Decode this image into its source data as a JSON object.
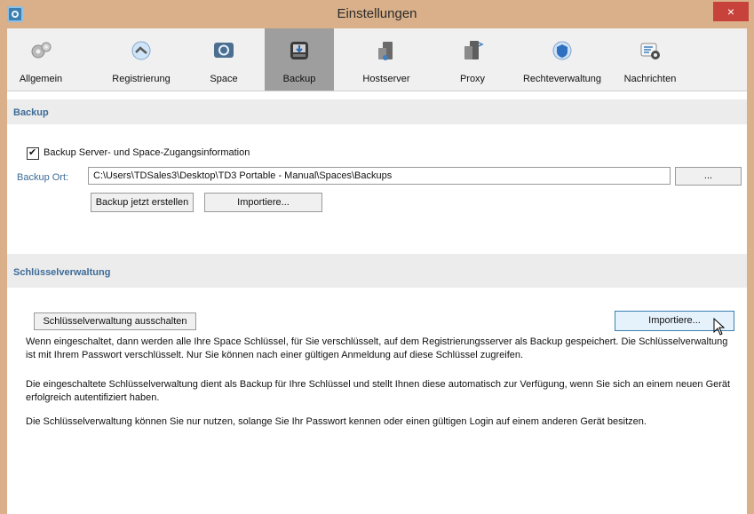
{
  "window": {
    "title": "Einstellungen",
    "close_glyph": "×"
  },
  "tabs": [
    {
      "label": "Allgemein",
      "icon": "gears-icon"
    },
    {
      "label": "Registrierung",
      "icon": "registration-icon"
    },
    {
      "label": "Space",
      "icon": "space-icon"
    },
    {
      "label": "Backup",
      "icon": "backup-icon",
      "active": true
    },
    {
      "label": "Hostserver",
      "icon": "hostserver-icon"
    },
    {
      "label": "Proxy",
      "icon": "proxy-icon"
    },
    {
      "label": "Rechteverwaltung",
      "icon": "rights-icon"
    },
    {
      "label": "Nachrichten",
      "icon": "messages-icon"
    }
  ],
  "backup": {
    "section_title": "Backup",
    "checkbox_label": "Backup Server- und Space-Zugangsinformation",
    "checkbox_checked": true,
    "location_label": "Backup Ort:",
    "location_value": "C:\\Users\\TDSales3\\Desktop\\TD3 Portable - Manual\\Spaces\\Backups",
    "browse_label": "...",
    "create_label": "Backup jetzt erstellen",
    "import_label": "Importiere..."
  },
  "keys": {
    "section_title": "Schlüsselverwaltung",
    "toggle_label": "Schlüsselverwaltung ausschalten",
    "import_label": "Importiere...",
    "paragraphs": [
      "Wenn eingeschaltet, dann werden alle Ihre Space Schlüssel, für Sie verschlüsselt, auf dem Registrierungsserver als Backup gespeichert. Die Schlüsselverwaltung ist mit Ihrem Passwort verschlüsselt. Nur Sie können nach einer gültigen Anmeldung auf diese Schlüssel zugreifen.",
      "Die eingeschaltete Schlüsselverwaltung dient als Backup für Ihre Schlüssel und stellt Ihnen diese automatisch zur Verfügung, wenn Sie sich an einem neuen Gerät erfolgreich autentifiziert haben.",
      "Die Schlüsselverwaltung können Sie nur nutzen, solange Sie Ihr Passwort kennen oder einen gültigen Login auf einem anderen Gerät besitzen."
    ]
  },
  "colors": {
    "titlebar": "#d9b08a",
    "close": "#c7423a",
    "section_text": "#3d6b98",
    "active_tab": "#9e9e9e"
  }
}
